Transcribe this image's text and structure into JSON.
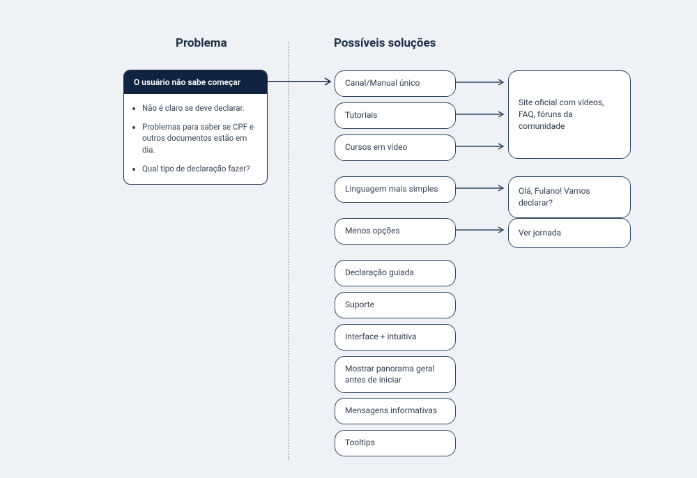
{
  "headings": {
    "problem": "Problema",
    "solutions": "Possíveis soluções"
  },
  "problem": {
    "title": "O usuário não sabe começar",
    "bullets": [
      "Não é claro se deve declarar.",
      "Problemas para saber se CPF e outros documentos estão em dia.",
      "Qual tipo de declaração fazer?"
    ]
  },
  "solutions": {
    "s0": "Canal/Manual único",
    "s1": "Tutoriais",
    "s2": "Cursos em vídeo",
    "s3": "Linguagem mais simples",
    "s4": "Menos opções",
    "s5": "Declaração guiada",
    "s6": "Suporte",
    "s7": "Interface + intuitiva",
    "s8": "Mostrar panorama geral antes de iniciar",
    "s9": "Mensagens informativas",
    "s10": "Tooltips"
  },
  "details": {
    "d0": "Site oficial com vídeos, FAQ, fóruns da comunidade",
    "d1": "Olá, Fulano! Vamos declarar?",
    "d2": "Ver jornada"
  }
}
